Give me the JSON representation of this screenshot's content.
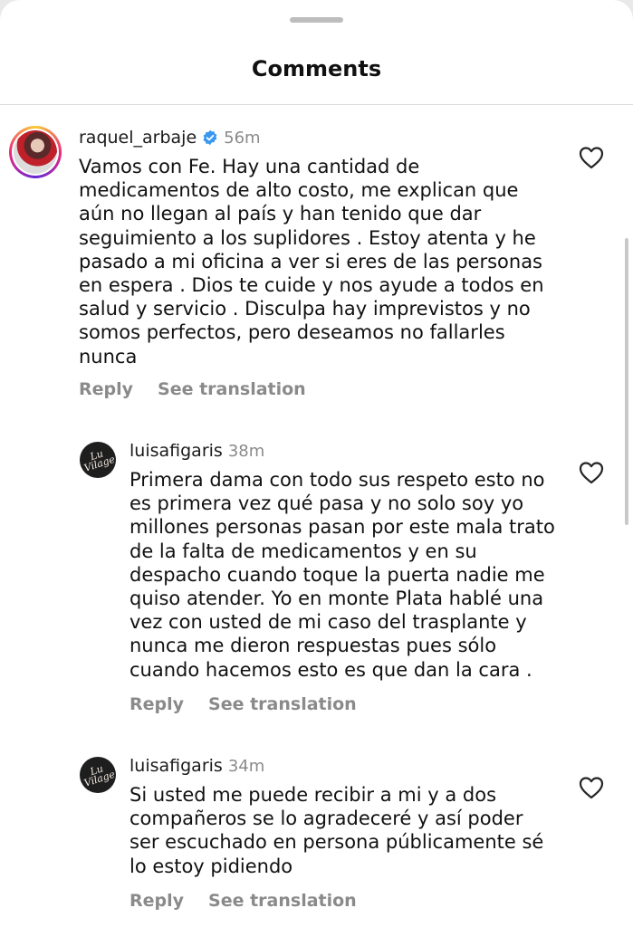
{
  "header": {
    "title": "Comments"
  },
  "comments": [
    {
      "username": "raquel_arbaje",
      "verified": true,
      "time": "56m",
      "text": "Vamos con Fe. Hay una cantidad de\nmedicamentos de alto costo, me explican que\naún no llegan al país y han tenido que dar\nseguimiento a los suplidores . Estoy atenta y he\npasado a mi oficina a ver si eres de las personas\nen espera . Dios te cuide y nos ayude a todos en\nsalud y servicio . Disculpa hay imprevistos y no\nsomos perfectos, pero deseamos no fallarles\nnunca",
      "reply_label": "Reply",
      "translate_label": "See translation",
      "avatar_icon": "profile-photo-icon"
    },
    {
      "username": "luisafigaris",
      "time": "38m",
      "text": "Primera dama con todo sus respeto esto no\nes primera vez qué pasa y no solo soy yo\nmillones personas pasan por este mala trato\nde la falta de medicamentos y en su\ndespacho cuando toque la puerta nadie me\nquiso atender. Yo en monte Plata hablé una\nvez con usted de mi caso del trasplante y\nnunca me dieron respuestas pues sólo\ncuando hacemos esto es que dan la cara .",
      "reply_label": "Reply",
      "translate_label": "See translation",
      "avatar_icon": "artist-logo-icon"
    },
    {
      "username": "luisafigaris",
      "time": "34m",
      "text": "Si usted me puede recibir a mi y a dos\ncompañeros se lo agradeceré y así poder\nser escuchado en persona públicamente sé\nlo estoy pidiendo",
      "reply_label": "Reply",
      "translate_label": "See translation",
      "avatar_icon": "artist-logo-icon"
    }
  ],
  "colors": {
    "background": "#ffffff",
    "muted_text": "#8a8a8a",
    "verified_blue": "#3897f0"
  }
}
